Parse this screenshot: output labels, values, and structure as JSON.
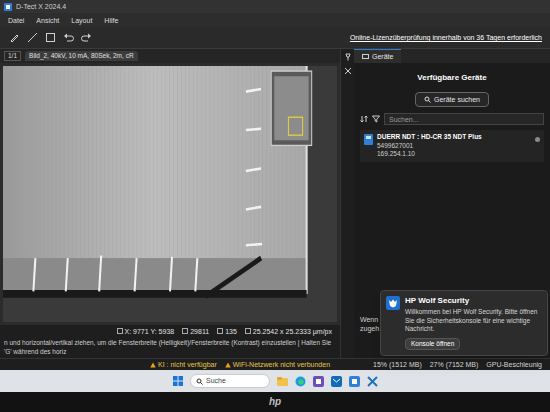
{
  "window": {
    "title": "D-Tect X 2024.4"
  },
  "menu": [
    "Datei",
    "Ansicht",
    "Layout",
    "Hilfe"
  ],
  "license_notice": "Online-Lizenzüberprüfung innerhalb von 36 Tagen erforderlich",
  "image_view": {
    "page": "1/1",
    "tab_label": "Bild_2, 40kV, 10 mA, 80Sek, 2m, cR",
    "status": [
      "X: 9771 Y: 5938",
      "29811",
      "135",
      "25.2542 x 25.2333 µm/px"
    ],
    "hint": "n und horizontal/vertikal ziehen, um die Fensterbreite (Helligkeit)/Fensterbreite (Kontrast) einzustellen | Halten Sie 'G' während des horiz"
  },
  "devices_panel": {
    "tab": "Geräte",
    "title": "Verfügbare Geräte",
    "search_button": "Geräte suchen",
    "search": {
      "placeholder": "Suchen..."
    },
    "devices": [
      {
        "name": "DUERR NDT : HD-CR 35 NDT Plus",
        "serial": "5499627001",
        "ip": "169.254.1.10"
      }
    ],
    "footer": [
      "Wenn",
      "zugeh"
    ]
  },
  "notification": {
    "title": "HP Wolf Security",
    "body": "Willkommen bei HP Wolf Security. Bitte öffnen Sie die Sicherheitskonsole für eine wichtige Nachricht.",
    "button": "Konsole öffnen"
  },
  "app_status": {
    "messages": [
      "KI : nicht verfügbar",
      "WiFi-Netzwerk nicht verbunden"
    ],
    "meters": [
      "15% (1512 MB)",
      "27% (7152 MB)",
      "GPU-Beschleunig"
    ]
  },
  "taskbar": {
    "search": {
      "placeholder": "Suche"
    }
  },
  "bezel_logo": "hp"
}
